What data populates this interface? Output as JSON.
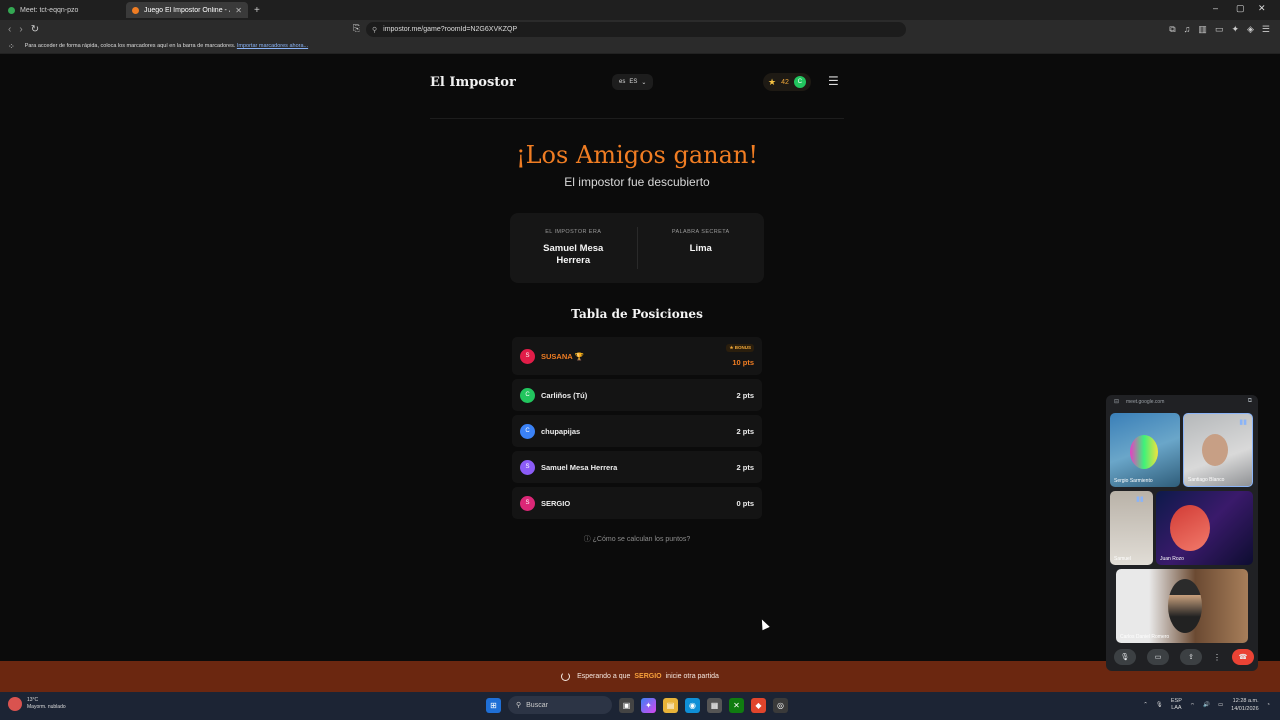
{
  "browser": {
    "tabs": [
      {
        "title": "Meet: tct-eqqn-pzo",
        "active": false,
        "favicon_color": "#34a853"
      },
      {
        "title": "Juego El Impostor Online - Juga",
        "active": true,
        "favicon_color": "#f07d23"
      }
    ],
    "url": "impostor.me/game?roomId=N2G6XVKZQP",
    "bookmark_hint": "Para acceder de forma rápida, coloca los marcadores aquí en la barra de marcadores.",
    "bookmark_link": "Importar marcadores ahora..."
  },
  "header": {
    "logo": "El Impostor",
    "lang_flag": "es",
    "lang_code": "ES",
    "stars": "42",
    "user_initial": "C"
  },
  "result": {
    "title": "¡Los Amigos ganan!",
    "subtitle": "El impostor fue descubierto",
    "impostor_label": "EL IMPOSTOR ERA",
    "impostor_name": "Samuel Mesa Herrera",
    "secret_label": "PALABRA SECRETA",
    "secret_word": "Lima"
  },
  "ranking": {
    "title": "Tabla de Posiciones",
    "bonus_label": "★ BONUS",
    "rows": [
      {
        "initial": "S",
        "name": "SUSANA 🏆",
        "points": "10 pts",
        "color": "#e11d48"
      },
      {
        "initial": "C",
        "name": "Carliños (Tú)",
        "points": "2 pts",
        "color": "#22c55e"
      },
      {
        "initial": "C",
        "name": "chupapijas",
        "points": "2 pts",
        "color": "#3b82f6"
      },
      {
        "initial": "S",
        "name": "Samuel Mesa Herrera",
        "points": "2 pts",
        "color": "#8b5cf6"
      },
      {
        "initial": "S",
        "name": "SERGIO",
        "points": "0 pts",
        "color": "#db2777"
      }
    ],
    "how_link": "¿Cómo se calculan los puntos?"
  },
  "waiting": {
    "prefix": "Esperando a que",
    "player": "SERGIO",
    "suffix": "inicie otra partida"
  },
  "meet": {
    "url": "meet.google.com",
    "participants": [
      "Sergio Sarmiento",
      "Santiago Blanco",
      "Samuel",
      "Juan Rozo",
      "Carlos Daniel Romero"
    ]
  },
  "taskbar": {
    "temp": "13°C",
    "weather": "Mayorm. nublado",
    "search": "Buscar",
    "lang_top": "ESP",
    "lang_bottom": "LAA",
    "time": "12:28 a.m.",
    "date": "14/01/2026"
  }
}
